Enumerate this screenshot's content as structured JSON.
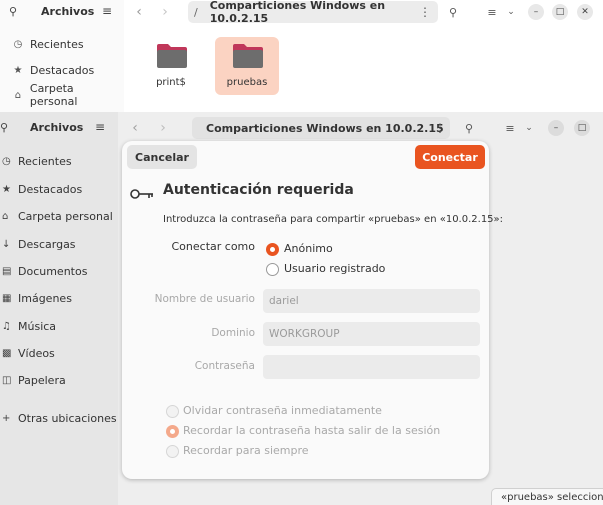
{
  "top": {
    "sidebar": {
      "search_icon": "search-icon",
      "title": "Archivos",
      "menu_icon": "hamburger-icon",
      "items": [
        {
          "label": "Recientes",
          "icon": "clock-icon"
        },
        {
          "label": "Destacados",
          "icon": "star-icon"
        },
        {
          "label": "Carpeta personal",
          "icon": "home-icon"
        }
      ]
    },
    "header": {
      "back": "‹",
      "forward": "›",
      "separator": "/",
      "path": "Comparticiones Windows en 10.0.2.15",
      "menu_dots": "⋮"
    },
    "files": [
      {
        "name": "print$",
        "selected": false
      },
      {
        "name": "pruebas",
        "selected": true
      }
    ]
  },
  "bottom": {
    "sidebar": {
      "title": "Archivos",
      "items": [
        {
          "label": "Recientes",
          "icon": "clock-icon"
        },
        {
          "label": "Destacados",
          "icon": "star-icon"
        },
        {
          "label": "Carpeta personal",
          "icon": "home-icon"
        },
        {
          "label": "Descargas",
          "icon": "download-icon"
        },
        {
          "label": "Documentos",
          "icon": "document-icon"
        },
        {
          "label": "Imágenes",
          "icon": "image-icon"
        },
        {
          "label": "Música",
          "icon": "music-icon"
        },
        {
          "label": "Vídeos",
          "icon": "video-icon"
        },
        {
          "label": "Papelera",
          "icon": "trash-icon"
        },
        {
          "label": "Otras ubicaciones",
          "icon": "plus-icon"
        }
      ]
    },
    "header": {
      "path": "Comparticiones Windows en 10.0.2.15"
    },
    "status": "«pruebas» seleccionada"
  },
  "dialog": {
    "cancel_label": "Cancelar",
    "connect_label": "Conectar",
    "title": "Autenticación requerida",
    "message": "Introduzca la contraseña para compartir «pruebas» en «10.0.2.15»:",
    "connect_as_label": "Conectar como",
    "connect_as_options": [
      {
        "label": "Anónimo",
        "selected": true
      },
      {
        "label": "Usuario registrado",
        "selected": false
      }
    ],
    "username_label": "Nombre de usuario",
    "username_value": "dariel",
    "domain_label": "Dominio",
    "domain_value": "WORKGROUP",
    "password_label": "Contraseña",
    "password_value": "",
    "remember_options": [
      {
        "label": "Olvidar contraseña inmediatamente",
        "selected": false
      },
      {
        "label": "Recordar la contraseña hasta salir de la sesión",
        "selected": true
      },
      {
        "label": "Recordar para siempre",
        "selected": false
      }
    ]
  },
  "colors": {
    "accent": "#e95420",
    "selected_folder_bg": "#fbd3c2",
    "folder_body": "#6d6d6d",
    "folder_tab": "#c0375a"
  }
}
